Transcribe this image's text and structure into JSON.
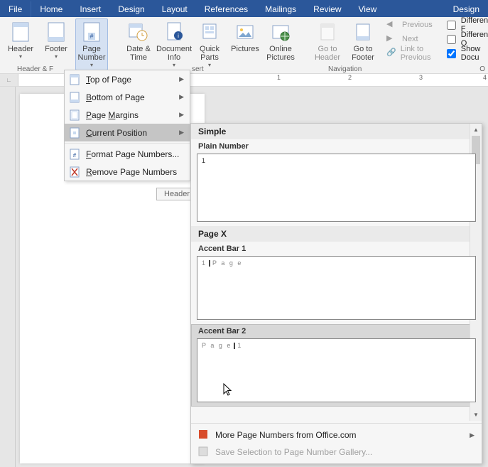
{
  "tabs": {
    "file": "File",
    "home": "Home",
    "insert": "Insert",
    "design": "Design",
    "layout": "Layout",
    "references": "References",
    "mailings": "Mailings",
    "review": "Review",
    "view": "View",
    "tooldesign": "Design"
  },
  "ribbon": {
    "header": "Header",
    "footer": "Footer",
    "pagenum": "Page\nNumber",
    "datetime": "Date &\nTime",
    "docinfo": "Document\nInfo",
    "quickparts": "Quick\nParts",
    "pictures": "Pictures",
    "onlinepics": "Online\nPictures",
    "gotoheader": "Go to\nHeader",
    "gotofooter": "Go to\nFooter",
    "previous": "Previous",
    "next": "Next",
    "linkprev": "Link to Previous",
    "group_hf": "Header & F",
    "group_insert": "sert",
    "group_nav": "Navigation",
    "group_op": "O",
    "diff_first": "Different F",
    "diff_odd": "Different O",
    "show_doc": "Show Docu"
  },
  "menu": {
    "top": "Top of Page",
    "bottom": "Bottom of Page",
    "margins": "Page Margins",
    "current": "Current Position",
    "format": "Format Page Numbers...",
    "remove": "Remove Page Numbers",
    "ac_t": "T",
    "ac_b": "B",
    "ac_m": "M",
    "ac_c": "C",
    "ac_f": "F",
    "ac_r": "R"
  },
  "gallery": {
    "simple": "Simple",
    "plain": "Plain Number",
    "pagex": "Page X",
    "accent1": "Accent Bar 1",
    "accent2": "Accent Bar 2",
    "page_text": "P a g e",
    "num1": "1",
    "more": "More Page Numbers from Office.com",
    "save": "Save Selection to Page Number Gallery..."
  },
  "page": {
    "header_label": "Header"
  },
  "ruler": {
    "m1": "1",
    "m2": "2",
    "m3": "3",
    "m4": "4"
  }
}
